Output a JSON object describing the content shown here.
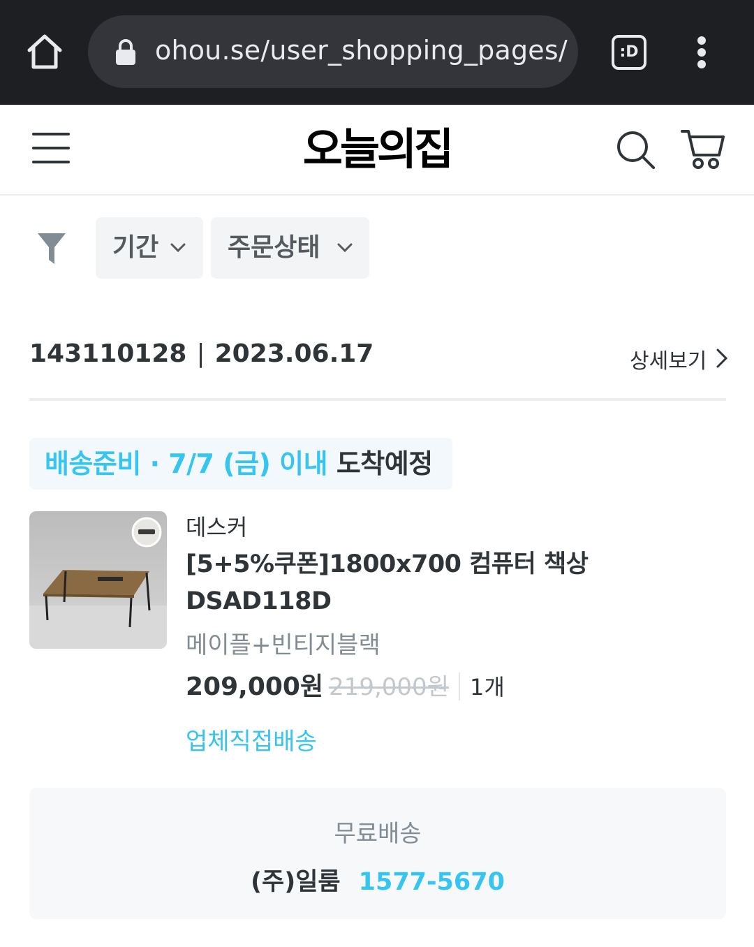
{
  "browser": {
    "url": "ohou.se/user_shopping_pages/",
    "extension_label": ":D"
  },
  "header": {
    "logo": "오늘의집"
  },
  "filters": {
    "period_label": "기간",
    "status_label": "주문상태"
  },
  "order": {
    "number": "143110128",
    "separator": "|",
    "date": "2023.06.17",
    "detail_label": "상세보기"
  },
  "delivery": {
    "status_prefix": "배송준비 · 7/7 (금) 이내",
    "status_suffix": "도착예정"
  },
  "product": {
    "brand": "데스커",
    "name": "[5+5%쿠폰]1800x700 컴퓨터 책상 DSAD118D",
    "option": "메이플+빈티지블랙",
    "price": "209,000원",
    "original_price": "219,000원",
    "quantity": "1개",
    "shipping_type": "업체직접배송"
  },
  "shipping_info": {
    "fee": "무료배송",
    "seller": "(주)일룸",
    "phone": "1577-5670"
  },
  "colors": {
    "accent": "#35c5f0",
    "text": "#2f3438",
    "muted": "#828c94",
    "browser_bar": "#1e1f22"
  }
}
